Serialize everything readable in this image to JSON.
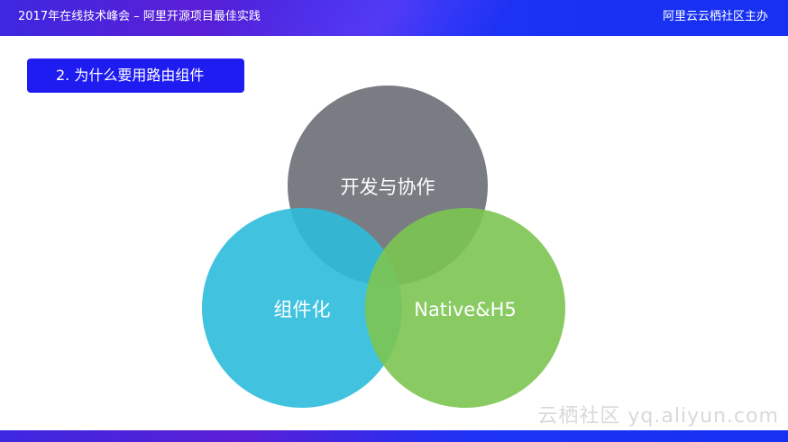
{
  "header": {
    "title": "2017年在线技术峰会 – 阿里开源项目最佳实践",
    "host": "阿里云云栖社区主办"
  },
  "section": {
    "title": "2. 为什么要用路由组件"
  },
  "venn": {
    "circles": [
      {
        "label": "开发与协作",
        "color": "#6b6e77"
      },
      {
        "label": "组件化",
        "color": "#2cbcdb"
      },
      {
        "label": "Native&H5",
        "color": "#7cc551"
      }
    ]
  },
  "watermark": "云栖社区 yq.aliyun.com",
  "colors": {
    "accent": "#1f1cf2",
    "header_gradient_start": "#3d28e0",
    "header_gradient_end": "#1730f2"
  }
}
